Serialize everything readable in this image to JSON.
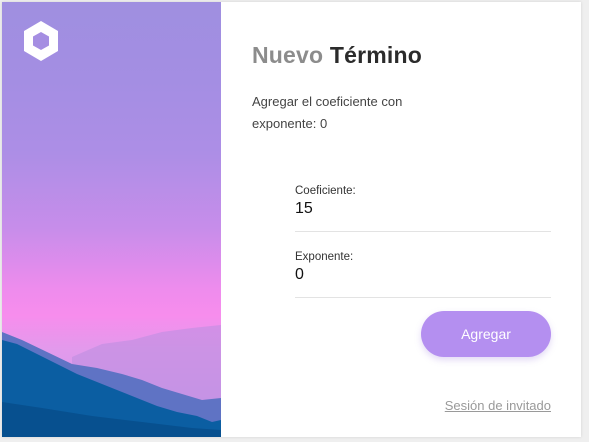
{
  "title": {
    "part1": "Nuevo",
    "part2": "Término"
  },
  "subtitle": "Agregar el coeficiente con exponente: 0",
  "fields": {
    "coefficient": {
      "label": "Coeficiente:",
      "value": "15"
    },
    "exponent": {
      "label": "Exponente:",
      "value": "0"
    }
  },
  "actions": {
    "add_label": "Agregar",
    "guest_label": "Sesión de invitado"
  },
  "colors": {
    "button": "#b48ff0",
    "hero_top": "#9f8fe0",
    "hero_pink": "#f78ded",
    "mountain_blue": "#0a5a9a"
  },
  "icons": {
    "logo": "hexagon-logo-icon"
  }
}
